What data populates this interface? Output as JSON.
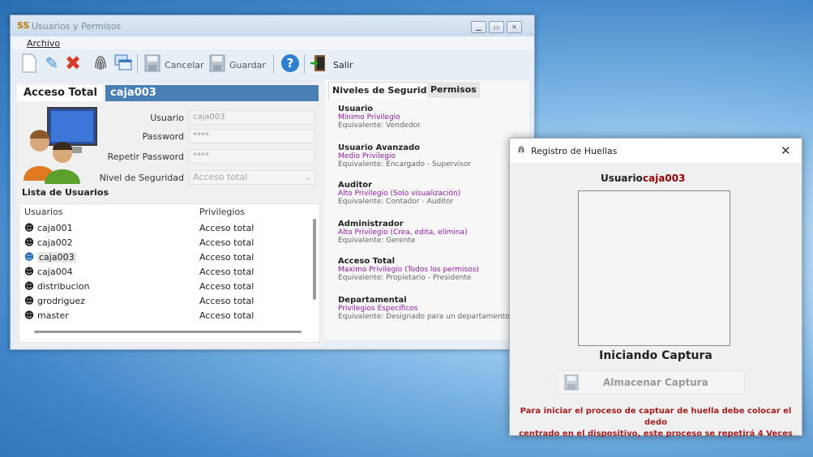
{
  "main_window": {
    "title": "Usuarios y Permisos",
    "app_icon": "SS",
    "menu": "Archivo",
    "toolbar": {
      "cancel_label": "Cancelar",
      "save_label": "Guardar",
      "exit_label": "Salir",
      "icons": [
        "new-icon",
        "edit-icon",
        "delete-icon",
        "fingerprint-icon",
        "windows-icon",
        "floppy-icon",
        "help-icon",
        "exit-door-icon"
      ]
    },
    "access_header_label": "Acceso Total",
    "access_header_user": "caja003",
    "form": {
      "usuario_label": "Usuario",
      "usuario_value": "caja003",
      "password_label": "Password",
      "password_value": "****",
      "repeat_label": "Repetir Password",
      "repeat_value": "****",
      "nivel_label": "Nivel de Seguridad",
      "nivel_value": "Acceso total"
    },
    "list_title": "Lista de Usuarios",
    "grid": {
      "col_user": "Usuarios",
      "col_priv": "Privilegios",
      "rows": [
        {
          "user": "caja001",
          "priv": "Acceso total"
        },
        {
          "user": "caja002",
          "priv": "Acceso total"
        },
        {
          "user": "caja003",
          "priv": "Acceso total"
        },
        {
          "user": "caja004",
          "priv": "Acceso total"
        },
        {
          "user": "distribucion",
          "priv": "Acceso total"
        },
        {
          "user": "grodriguez",
          "priv": "Acceso total"
        },
        {
          "user": "master",
          "priv": "Acceso total"
        }
      ],
      "selected": "caja003"
    },
    "tabs": [
      "Niveles de Seguridad",
      "Permisos"
    ],
    "levels": [
      {
        "name": "Usuario",
        "desc": "Mínimo Privilegio",
        "eq": "Equivalente: Vendedor"
      },
      {
        "name": "Usuario Avanzado",
        "desc": "Medio Privilegio",
        "eq": "Equivalente: Encargado - Supervisor"
      },
      {
        "name": "Auditor",
        "desc": "Alto Privilegio (Solo visualización)",
        "eq": "Equivalente: Contador - Auditor"
      },
      {
        "name": "Administrador",
        "desc": "Alto Privilegio (Crea, edita, elimina)",
        "eq": "Equivalente: Gerente"
      },
      {
        "name": "Acceso Total",
        "desc": "Maximo Privilegio (Todos los permisos)",
        "eq": "Equivalente: Propietario - Presidente"
      },
      {
        "name": "Departamental",
        "desc": "Privilegios Específicos",
        "eq": "Equivalente: Designado para un departamento"
      }
    ]
  },
  "dialog": {
    "title": "Registro de Huellas",
    "user_label": "Usuario",
    "user_value": "caja003",
    "status": "Iniciando Captura",
    "store_button": "Almacenar Captura",
    "message_line1": "Para iniciar el proceso de captuar de huella debe  colocar el dedo",
    "message_line2": "centrado en el dispositivo, este proceso se repetirá 4 Veces"
  },
  "colors": {
    "header_blue": "#4a7fb5",
    "privilege_purple": "#8b1a9c",
    "warning_red": "#a02020"
  }
}
